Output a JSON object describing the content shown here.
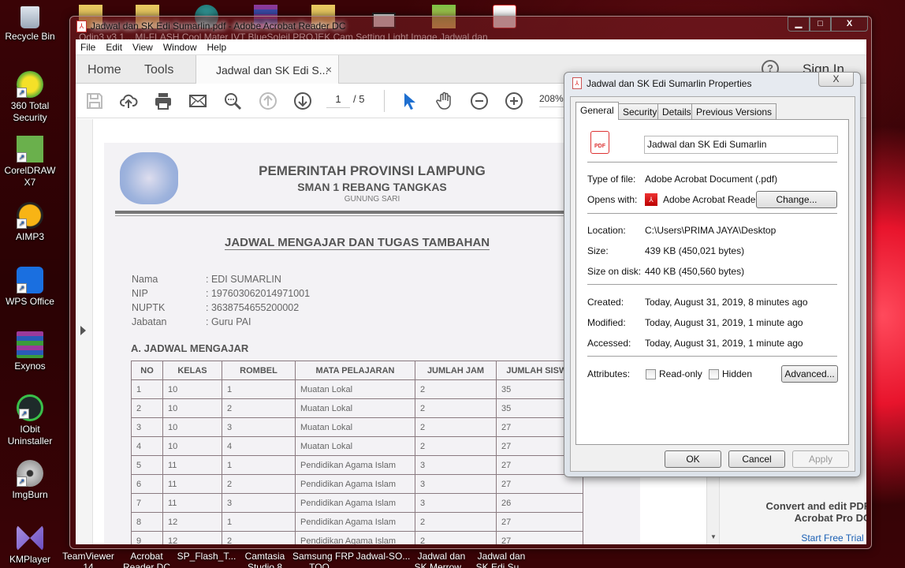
{
  "desktop": {
    "left_icons": [
      {
        "label": "Recycle Bin",
        "icon": "recycle-bin-icon"
      },
      {
        "label": "360 Total Security",
        "icon": "security-shield-icon"
      },
      {
        "label": "CorelDRAW X7",
        "icon": "coreldraw-icon"
      },
      {
        "label": "AIMP3",
        "icon": "aimp-icon"
      },
      {
        "label": "WPS Office",
        "icon": "wps-office-icon"
      },
      {
        "label": "Exynos",
        "icon": "winrar-archive-icon"
      },
      {
        "label": "IObit Uninstaller",
        "icon": "iobit-icon"
      },
      {
        "label": "ImgBurn",
        "icon": "imgburn-disc-icon"
      },
      {
        "label": "KMPlayer",
        "icon": "kmplayer-icon"
      }
    ],
    "bottom_icons": [
      {
        "label": "TeamViewer 14"
      },
      {
        "label": "Acrobat Reader DC"
      },
      {
        "label": "SP_Flash_T..."
      },
      {
        "label": "Camtasia Studio 8"
      },
      {
        "label": "Samsung FRP TOO..."
      },
      {
        "label": "Jadwal-SO..."
      },
      {
        "label": "Jadwal dan SK Merrow..."
      },
      {
        "label": "Jadwal dan SK Edi Su..."
      }
    ],
    "top_row_text": "Odin3 v3.1...   MI-FLASH   Cool Mater   IVT BlueSoleil   PROJEK   Cam Setting   Light Image   Jadwal dan"
  },
  "acrobat": {
    "window_title": "Jadwal dan SK Edi Sumarlin.pdf - Adobe Acrobat Reader DC",
    "window_controls": {
      "minimize": "▁",
      "maximize": "□",
      "close": "X"
    },
    "menu": [
      "File",
      "Edit",
      "View",
      "Window",
      "Help"
    ],
    "tabs": {
      "home": "Home",
      "tools": "Tools",
      "document": "Jadwal dan SK Edi S...",
      "close": "×"
    },
    "help": "?",
    "sign_in": "Sign In",
    "toolbar": {
      "page_current": "1",
      "page_total": "/ 5",
      "zoom": "208%"
    },
    "promo": {
      "headline": "Convert and edit PDFs with Acrobat Pro DC",
      "link": "Start Free Trial"
    },
    "document": {
      "header_1": "PEMERINTAH PROVINSI LAMPUNG",
      "header_2": "SMAN 1 REBANG TANGKAS",
      "header_3": "GUNUNG SARI",
      "title": "JADWAL MENGAJAR DAN TUGAS TAMBAHAN",
      "info": [
        {
          "label": "Nama",
          "value": ": EDI SUMARLIN"
        },
        {
          "label": "NIP",
          "value": ": 197603062014971001"
        },
        {
          "label": "NUPTK",
          "value": ": 3638754655200002"
        },
        {
          "label": "Jabatan",
          "value": ": Guru PAI"
        }
      ],
      "section_a": "A. JADWAL MENGAJAR",
      "table": {
        "headers": [
          "NO",
          "KELAS",
          "ROMBEL",
          "MATA PELAJARAN",
          "JUMLAH JAM",
          "JUMLAH SISWA"
        ],
        "rows": [
          [
            "1",
            "10",
            "1",
            "Muatan Lokal",
            "2",
            "35"
          ],
          [
            "2",
            "10",
            "2",
            "Muatan Lokal",
            "2",
            "35"
          ],
          [
            "3",
            "10",
            "3",
            "Muatan Lokal",
            "2",
            "27"
          ],
          [
            "4",
            "10",
            "4",
            "Muatan Lokal",
            "2",
            "27"
          ],
          [
            "5",
            "11",
            "1",
            "Pendidikan Agama Islam",
            "3",
            "27"
          ],
          [
            "6",
            "11",
            "2",
            "Pendidikan Agama Islam",
            "3",
            "27"
          ],
          [
            "7",
            "11",
            "3",
            "Pendidikan Agama Islam",
            "3",
            "26"
          ],
          [
            "8",
            "12",
            "1",
            "Pendidikan Agama Islam",
            "2",
            "27"
          ],
          [
            "9",
            "12",
            "2",
            "Pendidikan Agama Islam",
            "2",
            "27"
          ]
        ]
      }
    }
  },
  "properties": {
    "title": "Jadwal dan SK Edi Sumarlin Properties",
    "close": "X",
    "tabs": [
      "General",
      "Security",
      "Details",
      "Previous Versions"
    ],
    "active_tab": "General",
    "file_name": "Jadwal dan SK Edi Sumarlin",
    "type_label": "Type of file:",
    "type_value": "Adobe Acrobat Document (.pdf)",
    "opens_label": "Opens with:",
    "opens_value": "Adobe Acrobat Reader",
    "change_button": "Change...",
    "location_label": "Location:",
    "location_value": "C:\\Users\\PRIMA JAYA\\Desktop",
    "size_label": "Size:",
    "size_value": "439 KB (450,021 bytes)",
    "size_disk_label": "Size on disk:",
    "size_disk_value": "440 KB (450,560 bytes)",
    "created_label": "Created:",
    "created_value": "Today, August 31, 2019, 8 minutes ago",
    "modified_label": "Modified:",
    "modified_value": "Today, August 31, 2019, 1 minute ago",
    "accessed_label": "Accessed:",
    "accessed_value": "Today, August 31, 2019, 1 minute ago",
    "attributes_label": "Attributes:",
    "readonly_label": "Read-only",
    "readonly_checked": false,
    "hidden_label": "Hidden",
    "hidden_checked": false,
    "advanced_button": "Advanced...",
    "ok_button": "OK",
    "cancel_button": "Cancel",
    "apply_button": "Apply"
  }
}
